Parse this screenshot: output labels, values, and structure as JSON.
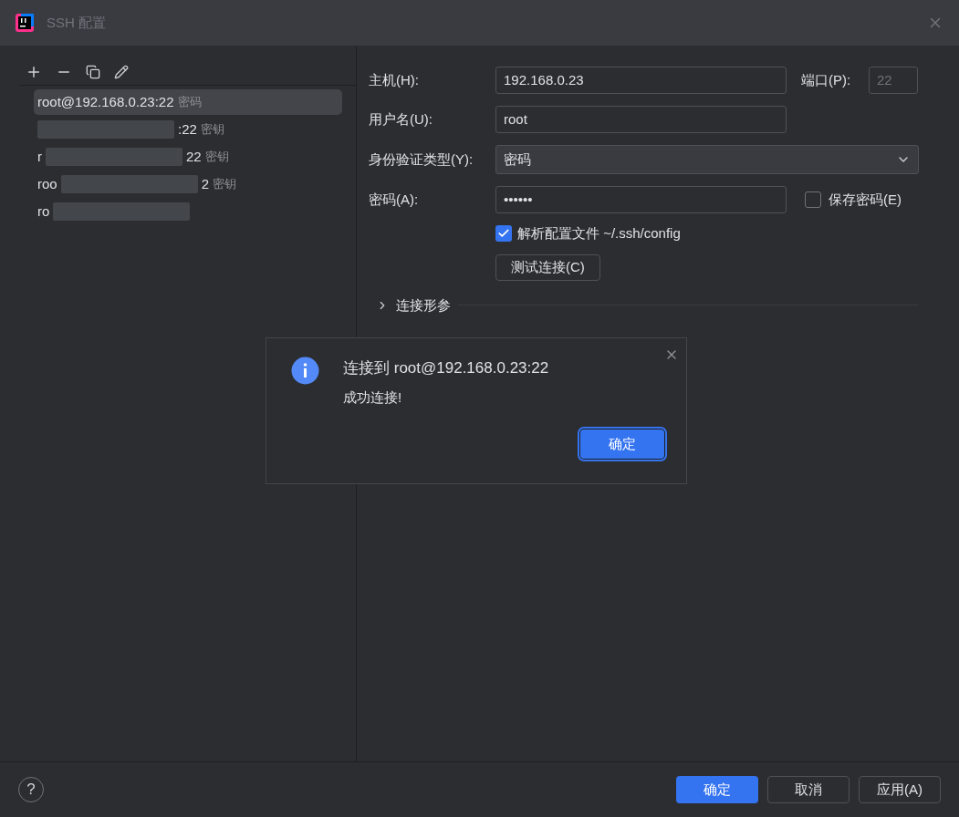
{
  "window": {
    "title": "SSH 配置"
  },
  "sidebar": {
    "items": [
      {
        "head": "root@192.168.0.23:22",
        "auth": "密码",
        "redacted": false,
        "selected": true
      },
      {
        "tail": ":22",
        "auth": "密钥",
        "redacted": true,
        "selected": false
      },
      {
        "head": "r",
        "tail": "22",
        "auth": "密钥",
        "redacted": true,
        "selected": false
      },
      {
        "head": "roo",
        "tail": "2",
        "auth": "密钥",
        "redacted": true,
        "selected": false
      },
      {
        "head": "ro",
        "redacted": true,
        "selected": false
      }
    ]
  },
  "form": {
    "host_label": "主机(H):",
    "host": "192.168.0.23",
    "port_label": "端口(P):",
    "port": "22",
    "user_label": "用户名(U):",
    "user": "root",
    "auth_label": "身份验证类型(Y):",
    "auth": "密码",
    "password_label": "密码(A):",
    "password": "••••••",
    "save_password": {
      "label": "保存密码(E)",
      "checked": false
    },
    "parse_config": {
      "label": "解析配置文件 ~/.ssh/config",
      "checked": true
    },
    "test_button": "测试连接(C)",
    "section": {
      "label": "连接形参",
      "expanded": false
    }
  },
  "dialog": {
    "title": "连接到 root@192.168.0.23:22",
    "message": "成功连接!",
    "ok": "确定"
  },
  "footer": {
    "help": "?",
    "buttons": [
      {
        "label": "确定",
        "primary": true
      },
      {
        "label": "取消",
        "primary": false
      },
      {
        "label": "应用(A)",
        "primary": false
      }
    ]
  }
}
